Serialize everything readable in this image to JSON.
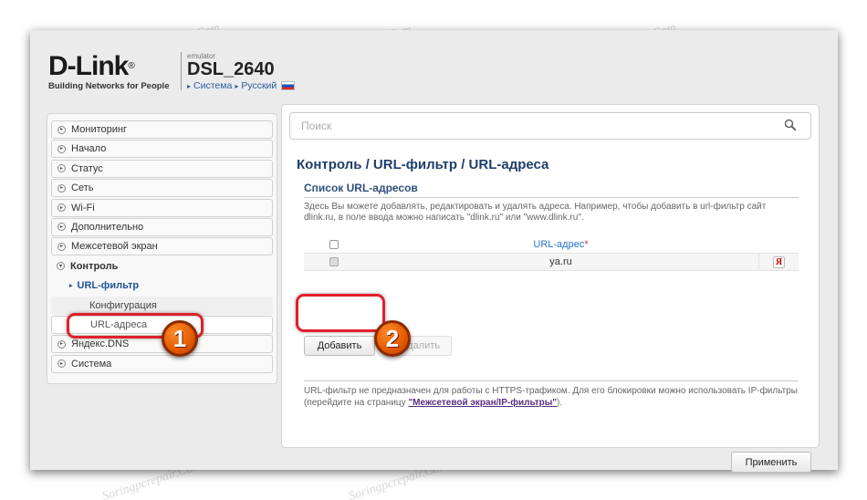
{
  "brand": {
    "logo_text": "D-Link",
    "tagline": "Building Networks for People",
    "emulator_label": "emulator",
    "model": "DSL_2640",
    "system_link": "Система",
    "language_link": "Русский"
  },
  "sidebar": {
    "items": [
      {
        "label": "Мониторинг"
      },
      {
        "label": "Начало"
      },
      {
        "label": "Статус"
      },
      {
        "label": "Сеть"
      },
      {
        "label": "Wi-Fi"
      },
      {
        "label": "Дополнительно"
      },
      {
        "label": "Межсетевой экран"
      },
      {
        "label": "Контроль"
      },
      {
        "label": "URL-фильтр"
      },
      {
        "label": "Конфигурация"
      },
      {
        "label": "URL-адреса"
      },
      {
        "label": "Яндекс.DNS"
      },
      {
        "label": "Система"
      }
    ]
  },
  "search": {
    "placeholder": "Поиск"
  },
  "breadcrumb": "Контроль /  URL-фильтр /  URL-адреса",
  "section": {
    "title": "Список URL-адресов",
    "description": "Здесь Вы можете добавлять, редактировать и удалять адреса. Например, чтобы добавить в url-фильтр сайт dlink.ru, в поле ввода можно написать \"dlink.ru\" или \"www.dlink.ru\"."
  },
  "table": {
    "header": "URL-адрес",
    "required_mark": "*",
    "rows": [
      {
        "url": "ya.ru",
        "icon": "Я"
      }
    ]
  },
  "buttons": {
    "add": "Добавить",
    "delete": "Удалить",
    "apply": "Применить"
  },
  "note": {
    "text": "URL-фильтр не предназначен для работы с HTTPS-трафиком. Для его блокировки можно использовать IP-фильтры (перейдите на страницу ",
    "link": "\"Межсетевой экран/IP-фильтры\"",
    "after": ")."
  },
  "annotations": {
    "badge1": "1",
    "badge2": "2"
  },
  "watermark": "Soringpcrepair.Com",
  "colors": {
    "highlight": "#e0202a",
    "badge": "#e25a00",
    "link": "#1f5296",
    "page_bg": "#ebebeb"
  }
}
